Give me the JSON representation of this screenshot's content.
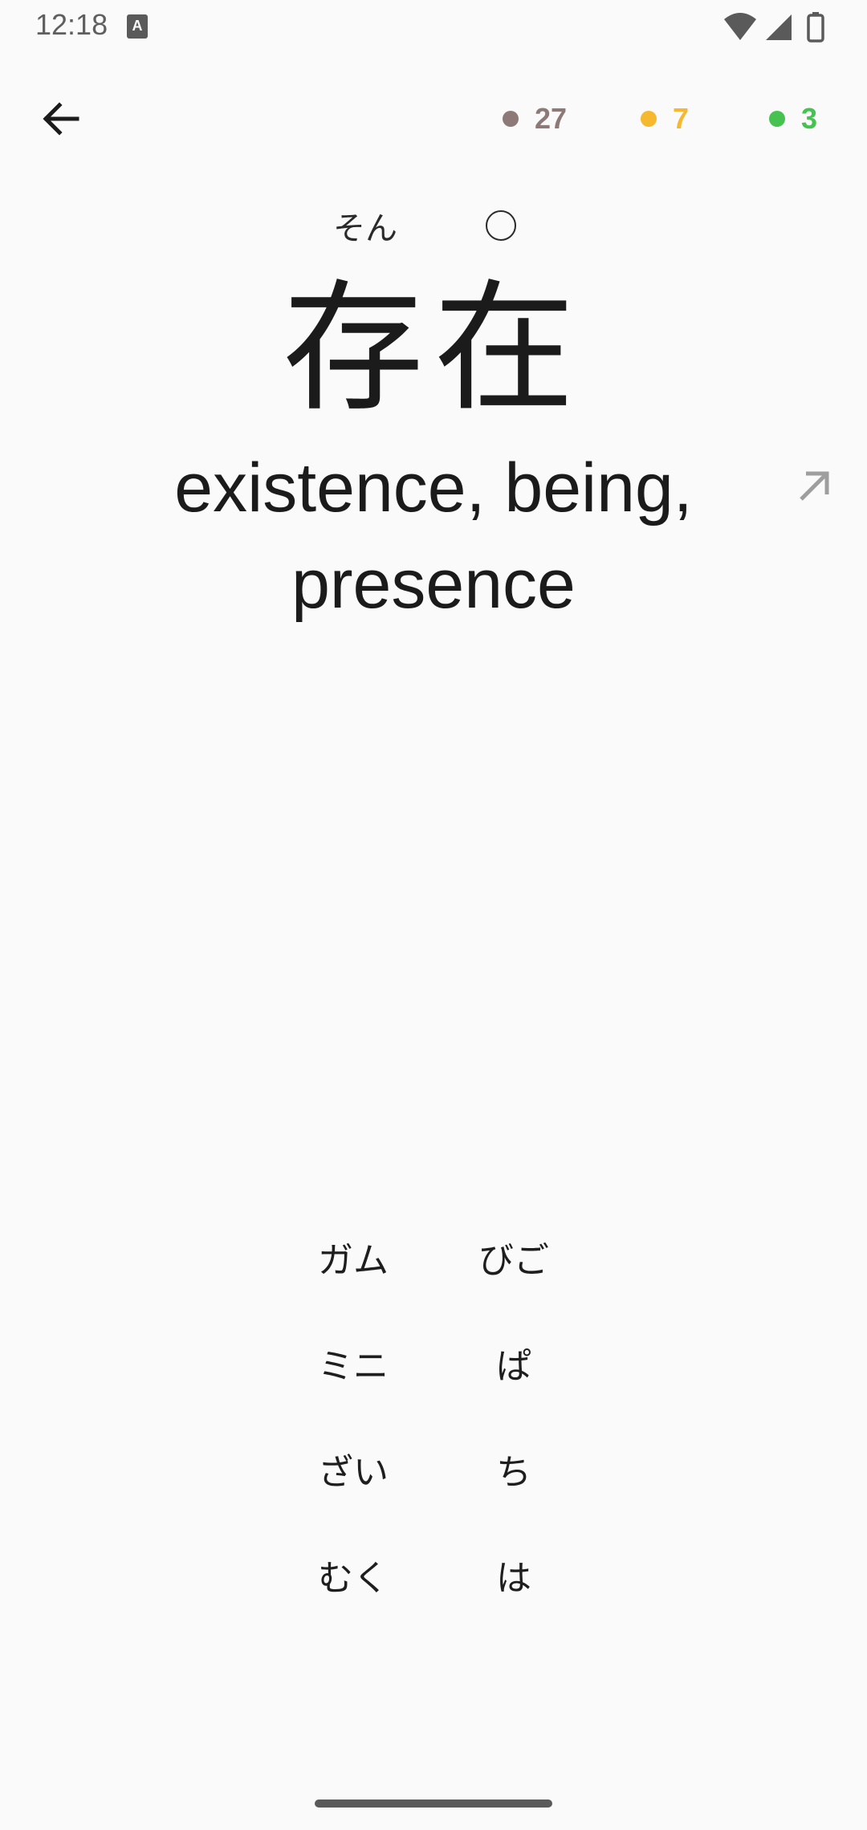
{
  "status_bar": {
    "time": "12:18",
    "notification_icon": "A",
    "icons": [
      "wifi-icon",
      "signal-icon",
      "battery-icon"
    ]
  },
  "header": {
    "back_icon": "arrow-left-icon",
    "counters": [
      {
        "value": "27",
        "color": "#8d7a78"
      },
      {
        "value": "7",
        "color": "#f5b82e"
      },
      {
        "value": "3",
        "color": "#45c24f"
      }
    ]
  },
  "card": {
    "reading": "そん",
    "word": "存在",
    "meaning": "existence, being, presence"
  },
  "options": [
    "ガム",
    "びご",
    "ミニ",
    "ぱ",
    "ざい",
    "ち",
    "むく",
    "は"
  ],
  "colors": {
    "background": "#fafafa",
    "text": "#1b1b1b",
    "muted_icon": "#9e9e9e"
  }
}
